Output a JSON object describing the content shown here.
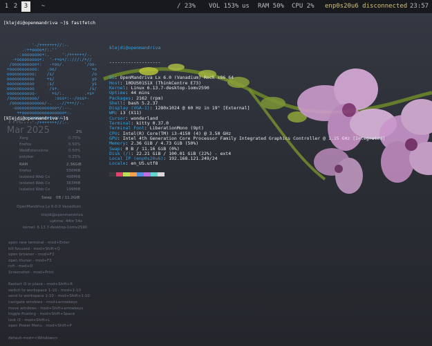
{
  "topbar": {
    "workspaces": [
      "1",
      "2",
      "3",
      "~"
    ],
    "active_workspace": "3",
    "disk": "/ 23%",
    "volume": "VOL 153%",
    "layout": "us",
    "ram": "RAM 50%",
    "cpu": "CPU  2%",
    "network": "enp0s20u6 disconnected",
    "clock": "23:57"
  },
  "terminal": {
    "prompt1": "[klejdi@openmandriva ~]$ fastfetch",
    "prompt2": "[klejdi@openmandriva ~]$",
    "logo_lines": [
      "          '-/+++++++//:-.",
      "      .:++oooo+/:.''",
      "    -:oooooooo+:.     ':/++++++/-.",
      "  -+ooooooooo+:  '-++o+/::///:/+//",
      " /oooooooooo+:   -+oo/.        '/oo-",
      "+ooooooooooo:   .oo/              +o",
      "ooooooooooo:    /s/               /o",
      "ooooooooooo     +s/               yo",
      "ooooooooooo     :s/               ys",
      "ooooooooooo      /s+.            /s/",
      "ooooooooooo-      +s/:.        .+s+",
      "/ooooooooooo/      :oss+:--/oss+-",
      " /ooooooooooooo/-.  .-//+++//-.",
      "  -ooooooooooooooooo+/:--.",
      "    ++ooooooooooooooooo+:.",
      "      ':+oooooooooooo/:.",
      "          '-/+++++++//:-."
    ],
    "user_host": "klejdi@openmandriva",
    "separator": "-------------------",
    "rows": [
      {
        "key": "OS",
        "value": "OpenMandriva Lx 6.0 (Vanadium) Rock x86_64"
      },
      {
        "key": "Host",
        "value": "10DUS01S1X (ThinkCentre E73)"
      },
      {
        "key": "Kernel",
        "value": "Linux 6.13.7-desktop-1omv2590"
      },
      {
        "key": "Uptime",
        "value": "44 mins"
      },
      {
        "key": "Packages",
        "value": "2162 (rpm)"
      },
      {
        "key": "Shell",
        "value": "bash 5.2.37"
      },
      {
        "key": "Display (VGA-1)",
        "value": "1280x1024 @ 60 Hz in 19\" [External]"
      },
      {
        "key": "WM",
        "value": "i3 (X11)"
      },
      {
        "key": "Cursor",
        "value": "wonderland"
      },
      {
        "key": "Terminal",
        "value": "kitty 0.37.0"
      },
      {
        "key": "Terminal Font",
        "value": "LiberationMono (9pt)"
      },
      {
        "key": "CPU",
        "value": "Intel(R) Core(TM) i3-4150 (4) @ 3.50 GHz"
      },
      {
        "key": "GPU",
        "value": "Intel 4th Generation Core Processor Family Integrated Graphics Controller @ 1.15 GHz [Integrated]"
      },
      {
        "key": "Memory",
        "value": "2.36 GiB / 4.73 GiB (50%)"
      },
      {
        "key": "Swap",
        "value": "0 B / 11.16 GiB (0%)"
      },
      {
        "key": "Disk (/)",
        "value": "22.21 GiB / 100.01 GiB (22%) - ext4"
      },
      {
        "key": "Local IP (enp0s20u6)",
        "value": "192.168.121.249/24"
      },
      {
        "key": "Locale",
        "value": "en_US.utf8"
      }
    ],
    "palette": [
      "#3a3a3a",
      "#e0456b",
      "#b7e35b",
      "#f6a14a",
      "#4f8fe0",
      "#c06fe0",
      "#5fd6d0",
      "#d9d9d9",
      "#777777",
      "#ff7a94"
    ]
  },
  "overlay": {
    "time_text": "The...",
    "date_text": "Mar 2025"
  },
  "conky": {
    "cpu_header": "2%",
    "procs": [
      {
        "name": "Xorg",
        "value": "0.75%"
      },
      {
        "name": "firefox",
        "value": "0.50%"
      },
      {
        "name": "WebExtensions",
        "value": "0.50%"
      },
      {
        "name": "polybar",
        "value": "0.25%"
      }
    ],
    "ram_label": "RAM",
    "ram_value": "2.36GiB",
    "mem_procs": [
      {
        "name": "firefox",
        "value": "556MiB"
      },
      {
        "name": "Isolated Web Co",
        "value": "498MiB"
      },
      {
        "name": "Isolated Web Co",
        "value": "363MiB"
      },
      {
        "name": "Isolated Web Co",
        "value": "199MiB"
      }
    ],
    "swap_label": "Swap",
    "swap_value": "0B / 11.2GiB",
    "os": "OpenMandriva Lx 6.0.0 Vanadium",
    "host": "klejdi@openmandriva",
    "uptime": "uptime: 44m 54s",
    "kernel": "kernel: 6.13.7-desktop-1omv2590",
    "shortcuts": [
      "open new terminal - mod+Enter",
      "kill focused - mod+Shift+Q",
      "open browser - mod+F2",
      "open thunar - mod+F3",
      "rofi - mod+D",
      "Screenshot - mod+Print",
      "",
      "Restart i3 in place - mod+Shift+R",
      "switch to workspace 1-10 - mod+1-10",
      "send to workspace 1-10 - mod+Shift+1-10",
      "navigate windows - mod+arrowkeys",
      "move windows - mod+Shift+arrowkeys",
      "toggle floating - mod+Shift+Space",
      "lock i3 - mod+Shift+L",
      "open Power Menu - mod+Shift+P",
      "",
      "default mod=<Windows>"
    ]
  }
}
